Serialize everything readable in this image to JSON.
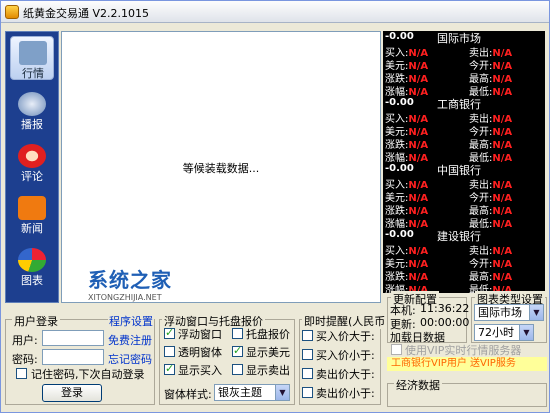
{
  "window": {
    "title": "纸黄金交易通 V2.2.1015"
  },
  "nav": [
    {
      "label": "行情",
      "icon": "chart-blocks-icon",
      "color": "#7fa0c8",
      "active": true
    },
    {
      "label": "播报",
      "icon": "broadcast-icon",
      "color": "#a0b8d8",
      "active": false
    },
    {
      "label": "评论",
      "icon": "commentator-icon",
      "color": "#e02020",
      "active": false
    },
    {
      "label": "新闻",
      "icon": "rss-feed-icon",
      "color": "#f07a10",
      "active": false
    },
    {
      "label": "图表",
      "icon": "pie-chart-icon",
      "color": "#8a55c8",
      "active": false
    }
  ],
  "content": {
    "loading_text": "等候装载数据...",
    "watermark_main": "系统之家",
    "watermark_sub": "XITONGZHIJIA.NET"
  },
  "quotes": {
    "sections": [
      {
        "value": "-0.00",
        "name": "国际市场",
        "rows": [
          {
            "lk": "买入:",
            "lv": "N/A",
            "rk": "卖出:",
            "rv": "N/A"
          },
          {
            "lk": "美元:",
            "lv": "N/A",
            "rk": "今开:",
            "rv": "N/A"
          },
          {
            "lk": "涨跌:",
            "lv": "N/A",
            "rk": "最高:",
            "rv": "N/A"
          },
          {
            "lk": "涨幅:",
            "lv": "N/A",
            "rk": "最低:",
            "rv": "N/A"
          }
        ]
      },
      {
        "value": "-0.00",
        "name": "工商银行",
        "rows": [
          {
            "lk": "买入:",
            "lv": "N/A",
            "rk": "卖出:",
            "rv": "N/A"
          },
          {
            "lk": "美元:",
            "lv": "N/A",
            "rk": "今开:",
            "rv": "N/A"
          },
          {
            "lk": "涨跌:",
            "lv": "N/A",
            "rk": "最高:",
            "rv": "N/A"
          },
          {
            "lk": "涨幅:",
            "lv": "N/A",
            "rk": "最低:",
            "rv": "N/A"
          }
        ]
      },
      {
        "value": "-0.00",
        "name": "中国银行",
        "rows": [
          {
            "lk": "买入:",
            "lv": "N/A",
            "rk": "卖出:",
            "rv": "N/A"
          },
          {
            "lk": "美元:",
            "lv": "N/A",
            "rk": "今开:",
            "rv": "N/A"
          },
          {
            "lk": "涨跌:",
            "lv": "N/A",
            "rk": "最高:",
            "rv": "N/A"
          },
          {
            "lk": "涨幅:",
            "lv": "N/A",
            "rk": "最低:",
            "rv": "N/A"
          }
        ]
      },
      {
        "value": "-0.00",
        "name": "建设银行",
        "rows": [
          {
            "lk": "买入:",
            "lv": "N/A",
            "rk": "卖出:",
            "rv": "N/A"
          },
          {
            "lk": "美元:",
            "lv": "N/A",
            "rk": "今开:",
            "rv": "N/A"
          },
          {
            "lk": "涨跌:",
            "lv": "N/A",
            "rk": "最高:",
            "rv": "N/A"
          },
          {
            "lk": "涨幅:",
            "lv": "N/A",
            "rk": "最低:",
            "rv": "N/A"
          }
        ]
      }
    ]
  },
  "login": {
    "title": "用户登录",
    "settings_link": "程序设置",
    "user_label": "用户:",
    "user_value": "",
    "register_link": "免费注册",
    "password_label": "密码:",
    "password_value": "",
    "forgot_link": "忘记密码",
    "remember_label": "记住密码,下次自动登录",
    "remember_checked": false,
    "login_button": "登录"
  },
  "floating": {
    "title": "浮动窗口与托盘报价",
    "options": [
      {
        "label": "浮动窗口",
        "checked": true
      },
      {
        "label": "托盘报价",
        "checked": false
      },
      {
        "label": "透明窗体",
        "checked": false
      },
      {
        "label": "显示美元",
        "checked": true
      },
      {
        "label": "显示买入",
        "checked": true
      },
      {
        "label": "显示卖出",
        "checked": false
      }
    ],
    "style_label": "窗体样式:",
    "style_value": "银灰主题"
  },
  "alerts": {
    "title": "即时提醒(人民币",
    "rows": [
      "买入价大于:",
      "买入价小于:",
      "卖出价大于:",
      "卖出价小于:"
    ]
  },
  "update": {
    "title": "更新配置",
    "local_label": "本机:",
    "local_time": "11:36:22",
    "update_label": "更新:",
    "update_time": "00:00:00",
    "holiday_label": "加载日数据"
  },
  "chart_type": {
    "title": "图表类型设置",
    "market_value": "国际市场",
    "period_value": "72小时"
  },
  "vip": {
    "label": "使用VIP实时行情服务器"
  },
  "news_bar": {
    "text": "工商银行VIP用户 送VIP服务"
  },
  "economics": {
    "title": "经济数据"
  }
}
